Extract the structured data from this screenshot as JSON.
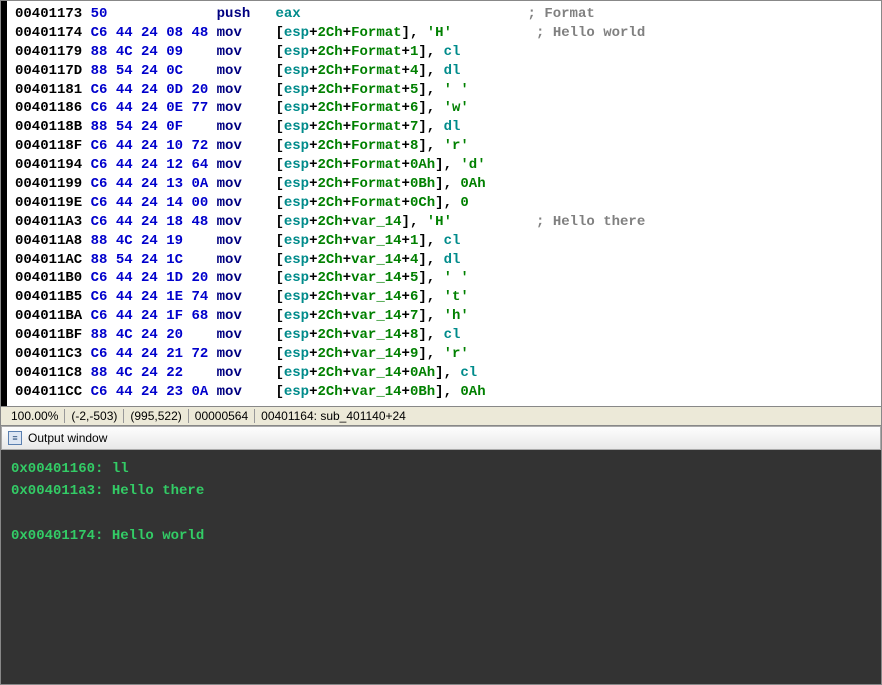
{
  "disasm": {
    "rows": [
      {
        "addr": "00401173",
        "bytes": "50            ",
        "mnem": "push",
        "op": [
          {
            "t": "reg",
            "v": "eax"
          }
        ],
        "cmt": "; Format"
      },
      {
        "addr": "00401174",
        "bytes": "C6 44 24 08 48",
        "mnem": "mov",
        "op": [
          {
            "t": "punct",
            "v": "["
          },
          {
            "t": "reg",
            "v": "esp"
          },
          {
            "t": "punct",
            "v": "+"
          },
          {
            "t": "num",
            "v": "2Ch"
          },
          {
            "t": "punct",
            "v": "+"
          },
          {
            "t": "sym",
            "v": "Format"
          },
          {
            "t": "punct",
            "v": "], "
          },
          {
            "t": "char",
            "v": "'H'"
          }
        ],
        "cmt": " ; Hello world"
      },
      {
        "addr": "00401179",
        "bytes": "88 4C 24 09   ",
        "mnem": "mov",
        "op": [
          {
            "t": "punct",
            "v": "["
          },
          {
            "t": "reg",
            "v": "esp"
          },
          {
            "t": "punct",
            "v": "+"
          },
          {
            "t": "num",
            "v": "2Ch"
          },
          {
            "t": "punct",
            "v": "+"
          },
          {
            "t": "sym",
            "v": "Format"
          },
          {
            "t": "punct",
            "v": "+"
          },
          {
            "t": "num",
            "v": "1"
          },
          {
            "t": "punct",
            "v": "], "
          },
          {
            "t": "reg",
            "v": "cl"
          }
        ]
      },
      {
        "addr": "0040117D",
        "bytes": "88 54 24 0C   ",
        "mnem": "mov",
        "op": [
          {
            "t": "punct",
            "v": "["
          },
          {
            "t": "reg",
            "v": "esp"
          },
          {
            "t": "punct",
            "v": "+"
          },
          {
            "t": "num",
            "v": "2Ch"
          },
          {
            "t": "punct",
            "v": "+"
          },
          {
            "t": "sym",
            "v": "Format"
          },
          {
            "t": "punct",
            "v": "+"
          },
          {
            "t": "num",
            "v": "4"
          },
          {
            "t": "punct",
            "v": "], "
          },
          {
            "t": "reg",
            "v": "dl"
          }
        ]
      },
      {
        "addr": "00401181",
        "bytes": "C6 44 24 0D 20",
        "mnem": "mov",
        "op": [
          {
            "t": "punct",
            "v": "["
          },
          {
            "t": "reg",
            "v": "esp"
          },
          {
            "t": "punct",
            "v": "+"
          },
          {
            "t": "num",
            "v": "2Ch"
          },
          {
            "t": "punct",
            "v": "+"
          },
          {
            "t": "sym",
            "v": "Format"
          },
          {
            "t": "punct",
            "v": "+"
          },
          {
            "t": "num",
            "v": "5"
          },
          {
            "t": "punct",
            "v": "], "
          },
          {
            "t": "char",
            "v": "' '"
          }
        ]
      },
      {
        "addr": "00401186",
        "bytes": "C6 44 24 0E 77",
        "mnem": "mov",
        "op": [
          {
            "t": "punct",
            "v": "["
          },
          {
            "t": "reg",
            "v": "esp"
          },
          {
            "t": "punct",
            "v": "+"
          },
          {
            "t": "num",
            "v": "2Ch"
          },
          {
            "t": "punct",
            "v": "+"
          },
          {
            "t": "sym",
            "v": "Format"
          },
          {
            "t": "punct",
            "v": "+"
          },
          {
            "t": "num",
            "v": "6"
          },
          {
            "t": "punct",
            "v": "], "
          },
          {
            "t": "char",
            "v": "'w'"
          }
        ]
      },
      {
        "addr": "0040118B",
        "bytes": "88 54 24 0F   ",
        "mnem": "mov",
        "op": [
          {
            "t": "punct",
            "v": "["
          },
          {
            "t": "reg",
            "v": "esp"
          },
          {
            "t": "punct",
            "v": "+"
          },
          {
            "t": "num",
            "v": "2Ch"
          },
          {
            "t": "punct",
            "v": "+"
          },
          {
            "t": "sym",
            "v": "Format"
          },
          {
            "t": "punct",
            "v": "+"
          },
          {
            "t": "num",
            "v": "7"
          },
          {
            "t": "punct",
            "v": "], "
          },
          {
            "t": "reg",
            "v": "dl"
          }
        ]
      },
      {
        "addr": "0040118F",
        "bytes": "C6 44 24 10 72",
        "mnem": "mov",
        "op": [
          {
            "t": "punct",
            "v": "["
          },
          {
            "t": "reg",
            "v": "esp"
          },
          {
            "t": "punct",
            "v": "+"
          },
          {
            "t": "num",
            "v": "2Ch"
          },
          {
            "t": "punct",
            "v": "+"
          },
          {
            "t": "sym",
            "v": "Format"
          },
          {
            "t": "punct",
            "v": "+"
          },
          {
            "t": "num",
            "v": "8"
          },
          {
            "t": "punct",
            "v": "], "
          },
          {
            "t": "char",
            "v": "'r'"
          }
        ]
      },
      {
        "addr": "00401194",
        "bytes": "C6 44 24 12 64",
        "mnem": "mov",
        "op": [
          {
            "t": "punct",
            "v": "["
          },
          {
            "t": "reg",
            "v": "esp"
          },
          {
            "t": "punct",
            "v": "+"
          },
          {
            "t": "num",
            "v": "2Ch"
          },
          {
            "t": "punct",
            "v": "+"
          },
          {
            "t": "sym",
            "v": "Format"
          },
          {
            "t": "punct",
            "v": "+"
          },
          {
            "t": "num",
            "v": "0Ah"
          },
          {
            "t": "punct",
            "v": "], "
          },
          {
            "t": "char",
            "v": "'d'"
          }
        ]
      },
      {
        "addr": "00401199",
        "bytes": "C6 44 24 13 0A",
        "mnem": "mov",
        "op": [
          {
            "t": "punct",
            "v": "["
          },
          {
            "t": "reg",
            "v": "esp"
          },
          {
            "t": "punct",
            "v": "+"
          },
          {
            "t": "num",
            "v": "2Ch"
          },
          {
            "t": "punct",
            "v": "+"
          },
          {
            "t": "sym",
            "v": "Format"
          },
          {
            "t": "punct",
            "v": "+"
          },
          {
            "t": "num",
            "v": "0Bh"
          },
          {
            "t": "punct",
            "v": "], "
          },
          {
            "t": "num",
            "v": "0Ah"
          }
        ]
      },
      {
        "addr": "0040119E",
        "bytes": "C6 44 24 14 00",
        "mnem": "mov",
        "op": [
          {
            "t": "punct",
            "v": "["
          },
          {
            "t": "reg",
            "v": "esp"
          },
          {
            "t": "punct",
            "v": "+"
          },
          {
            "t": "num",
            "v": "2Ch"
          },
          {
            "t": "punct",
            "v": "+"
          },
          {
            "t": "sym",
            "v": "Format"
          },
          {
            "t": "punct",
            "v": "+"
          },
          {
            "t": "num",
            "v": "0Ch"
          },
          {
            "t": "punct",
            "v": "], "
          },
          {
            "t": "num",
            "v": "0"
          }
        ]
      },
      {
        "addr": "004011A3",
        "bytes": "C6 44 24 18 48",
        "mnem": "mov",
        "op": [
          {
            "t": "punct",
            "v": "["
          },
          {
            "t": "reg",
            "v": "esp"
          },
          {
            "t": "punct",
            "v": "+"
          },
          {
            "t": "num",
            "v": "2Ch"
          },
          {
            "t": "punct",
            "v": "+"
          },
          {
            "t": "sym",
            "v": "var_14"
          },
          {
            "t": "punct",
            "v": "], "
          },
          {
            "t": "char",
            "v": "'H'"
          }
        ],
        "cmt": " ; Hello there"
      },
      {
        "addr": "004011A8",
        "bytes": "88 4C 24 19   ",
        "mnem": "mov",
        "op": [
          {
            "t": "punct",
            "v": "["
          },
          {
            "t": "reg",
            "v": "esp"
          },
          {
            "t": "punct",
            "v": "+"
          },
          {
            "t": "num",
            "v": "2Ch"
          },
          {
            "t": "punct",
            "v": "+"
          },
          {
            "t": "sym",
            "v": "var_14"
          },
          {
            "t": "punct",
            "v": "+"
          },
          {
            "t": "num",
            "v": "1"
          },
          {
            "t": "punct",
            "v": "], "
          },
          {
            "t": "reg",
            "v": "cl"
          }
        ]
      },
      {
        "addr": "004011AC",
        "bytes": "88 54 24 1C   ",
        "mnem": "mov",
        "op": [
          {
            "t": "punct",
            "v": "["
          },
          {
            "t": "reg",
            "v": "esp"
          },
          {
            "t": "punct",
            "v": "+"
          },
          {
            "t": "num",
            "v": "2Ch"
          },
          {
            "t": "punct",
            "v": "+"
          },
          {
            "t": "sym",
            "v": "var_14"
          },
          {
            "t": "punct",
            "v": "+"
          },
          {
            "t": "num",
            "v": "4"
          },
          {
            "t": "punct",
            "v": "], "
          },
          {
            "t": "reg",
            "v": "dl"
          }
        ]
      },
      {
        "addr": "004011B0",
        "bytes": "C6 44 24 1D 20",
        "mnem": "mov",
        "op": [
          {
            "t": "punct",
            "v": "["
          },
          {
            "t": "reg",
            "v": "esp"
          },
          {
            "t": "punct",
            "v": "+"
          },
          {
            "t": "num",
            "v": "2Ch"
          },
          {
            "t": "punct",
            "v": "+"
          },
          {
            "t": "sym",
            "v": "var_14"
          },
          {
            "t": "punct",
            "v": "+"
          },
          {
            "t": "num",
            "v": "5"
          },
          {
            "t": "punct",
            "v": "], "
          },
          {
            "t": "char",
            "v": "' '"
          }
        ]
      },
      {
        "addr": "004011B5",
        "bytes": "C6 44 24 1E 74",
        "mnem": "mov",
        "op": [
          {
            "t": "punct",
            "v": "["
          },
          {
            "t": "reg",
            "v": "esp"
          },
          {
            "t": "punct",
            "v": "+"
          },
          {
            "t": "num",
            "v": "2Ch"
          },
          {
            "t": "punct",
            "v": "+"
          },
          {
            "t": "sym",
            "v": "var_14"
          },
          {
            "t": "punct",
            "v": "+"
          },
          {
            "t": "num",
            "v": "6"
          },
          {
            "t": "punct",
            "v": "], "
          },
          {
            "t": "char",
            "v": "'t'"
          }
        ]
      },
      {
        "addr": "004011BA",
        "bytes": "C6 44 24 1F 68",
        "mnem": "mov",
        "op": [
          {
            "t": "punct",
            "v": "["
          },
          {
            "t": "reg",
            "v": "esp"
          },
          {
            "t": "punct",
            "v": "+"
          },
          {
            "t": "num",
            "v": "2Ch"
          },
          {
            "t": "punct",
            "v": "+"
          },
          {
            "t": "sym",
            "v": "var_14"
          },
          {
            "t": "punct",
            "v": "+"
          },
          {
            "t": "num",
            "v": "7"
          },
          {
            "t": "punct",
            "v": "], "
          },
          {
            "t": "char",
            "v": "'h'"
          }
        ]
      },
      {
        "addr": "004011BF",
        "bytes": "88 4C 24 20   ",
        "mnem": "mov",
        "op": [
          {
            "t": "punct",
            "v": "["
          },
          {
            "t": "reg",
            "v": "esp"
          },
          {
            "t": "punct",
            "v": "+"
          },
          {
            "t": "num",
            "v": "2Ch"
          },
          {
            "t": "punct",
            "v": "+"
          },
          {
            "t": "sym",
            "v": "var_14"
          },
          {
            "t": "punct",
            "v": "+"
          },
          {
            "t": "num",
            "v": "8"
          },
          {
            "t": "punct",
            "v": "], "
          },
          {
            "t": "reg",
            "v": "cl"
          }
        ]
      },
      {
        "addr": "004011C3",
        "bytes": "C6 44 24 21 72",
        "mnem": "mov",
        "op": [
          {
            "t": "punct",
            "v": "["
          },
          {
            "t": "reg",
            "v": "esp"
          },
          {
            "t": "punct",
            "v": "+"
          },
          {
            "t": "num",
            "v": "2Ch"
          },
          {
            "t": "punct",
            "v": "+"
          },
          {
            "t": "sym",
            "v": "var_14"
          },
          {
            "t": "punct",
            "v": "+"
          },
          {
            "t": "num",
            "v": "9"
          },
          {
            "t": "punct",
            "v": "], "
          },
          {
            "t": "char",
            "v": "'r'"
          }
        ]
      },
      {
        "addr": "004011C8",
        "bytes": "88 4C 24 22   ",
        "mnem": "mov",
        "op": [
          {
            "t": "punct",
            "v": "["
          },
          {
            "t": "reg",
            "v": "esp"
          },
          {
            "t": "punct",
            "v": "+"
          },
          {
            "t": "num",
            "v": "2Ch"
          },
          {
            "t": "punct",
            "v": "+"
          },
          {
            "t": "sym",
            "v": "var_14"
          },
          {
            "t": "punct",
            "v": "+"
          },
          {
            "t": "num",
            "v": "0Ah"
          },
          {
            "t": "punct",
            "v": "], "
          },
          {
            "t": "reg",
            "v": "cl"
          }
        ]
      },
      {
        "addr": "004011CC",
        "bytes": "C6 44 24 23 0A",
        "mnem": "mov",
        "op": [
          {
            "t": "punct",
            "v": "["
          },
          {
            "t": "reg",
            "v": "esp"
          },
          {
            "t": "punct",
            "v": "+"
          },
          {
            "t": "num",
            "v": "2Ch"
          },
          {
            "t": "punct",
            "v": "+"
          },
          {
            "t": "sym",
            "v": "var_14"
          },
          {
            "t": "punct",
            "v": "+"
          },
          {
            "t": "num",
            "v": "0Bh"
          },
          {
            "t": "punct",
            "v": "], "
          },
          {
            "t": "num",
            "v": "0Ah"
          }
        ]
      }
    ]
  },
  "statusbar": {
    "zoom": "100.00%",
    "coord1": "(-2,-503)",
    "coord2": "(995,522)",
    "offset": "00000564",
    "loc": "00401164: sub_401140+24"
  },
  "output_panel": {
    "title": "Output window",
    "lines": [
      "0x00401160: ll",
      "0x004011a3: Hello there",
      "",
      "0x00401174: Hello world"
    ]
  }
}
